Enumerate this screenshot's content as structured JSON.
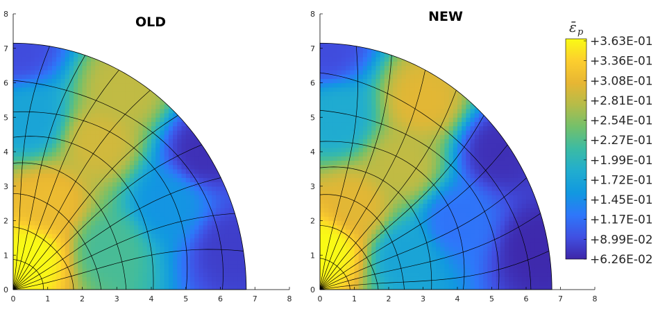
{
  "chart_data": [
    {
      "type": "heatmap",
      "title": "OLD",
      "xlim": [
        0,
        8
      ],
      "ylim": [
        0,
        8
      ],
      "xticks": [
        "0",
        "1",
        "2",
        "3",
        "4",
        "5",
        "6",
        "7",
        "8"
      ],
      "yticks": [
        "0",
        "1",
        "2",
        "3",
        "4",
        "5",
        "6",
        "7",
        "8"
      ],
      "domain_shape": "quarter-ellipse",
      "semi_axis_x": 6.75,
      "semi_axis_y": 7.15,
      "field_samples": [
        {
          "x": 0.5,
          "y": 1.0,
          "value": 0.363
        },
        {
          "x": 1.0,
          "y": 2.5,
          "value": 0.31
        },
        {
          "x": 2.5,
          "y": 4.3,
          "value": 0.29
        },
        {
          "x": 3.2,
          "y": 5.8,
          "value": 0.28
        },
        {
          "x": 2.8,
          "y": 1.2,
          "value": 0.22
        },
        {
          "x": 4.5,
          "y": 2.5,
          "value": 0.15
        },
        {
          "x": 6.3,
          "y": 1.2,
          "value": 0.08
        },
        {
          "x": 5.5,
          "y": 4.0,
          "value": 0.07
        },
        {
          "x": 0.2,
          "y": 7.0,
          "value": 0.09
        },
        {
          "x": 0.5,
          "y": 5.0,
          "value": 0.17
        }
      ]
    },
    {
      "type": "heatmap",
      "title": "NEW",
      "xlim": [
        0,
        8
      ],
      "ylim": [
        0,
        8
      ],
      "xticks": [
        "0",
        "1",
        "2",
        "3",
        "4",
        "5",
        "6",
        "7",
        "8"
      ],
      "yticks": [
        "0",
        "1",
        "2",
        "3",
        "4",
        "5",
        "6",
        "7",
        "8"
      ],
      "domain_shape": "quarter-ellipse",
      "semi_axis_x": 6.75,
      "semi_axis_y": 7.15,
      "field_samples": [
        {
          "x": 0.2,
          "y": 1.2,
          "value": 0.363
        },
        {
          "x": 1.0,
          "y": 2.4,
          "value": 0.3
        },
        {
          "x": 2.4,
          "y": 3.6,
          "value": 0.28
        },
        {
          "x": 3.0,
          "y": 5.5,
          "value": 0.3
        },
        {
          "x": 2.5,
          "y": 1.0,
          "value": 0.17
        },
        {
          "x": 4.0,
          "y": 2.0,
          "value": 0.12
        },
        {
          "x": 6.3,
          "y": 1.2,
          "value": 0.065
        },
        {
          "x": 5.2,
          "y": 4.0,
          "value": 0.07
        },
        {
          "x": 0.2,
          "y": 7.0,
          "value": 0.09
        },
        {
          "x": 0.5,
          "y": 5.0,
          "value": 0.18
        }
      ]
    }
  ],
  "colorbar": {
    "symbol": "ε̄",
    "symbol_sub": "p",
    "labels": [
      "+3.63E-01",
      "+3.36E-01",
      "+3.08E-01",
      "+2.81E-01",
      "+2.54E-01",
      "+2.27E-01",
      "+1.99E-01",
      "+1.72E-01",
      "+1.45E-01",
      "+1.17E-01",
      "+8.99E-02",
      "+6.26E-02"
    ],
    "min": 0.0626,
    "max": 0.363,
    "colormap": [
      "#3e26a8",
      "#4050e2",
      "#2e77fa",
      "#1198e0",
      "#21adcf",
      "#3bbba4",
      "#73c06b",
      "#b5bc49",
      "#e7b633",
      "#fcce2e",
      "#f9fb15"
    ]
  }
}
